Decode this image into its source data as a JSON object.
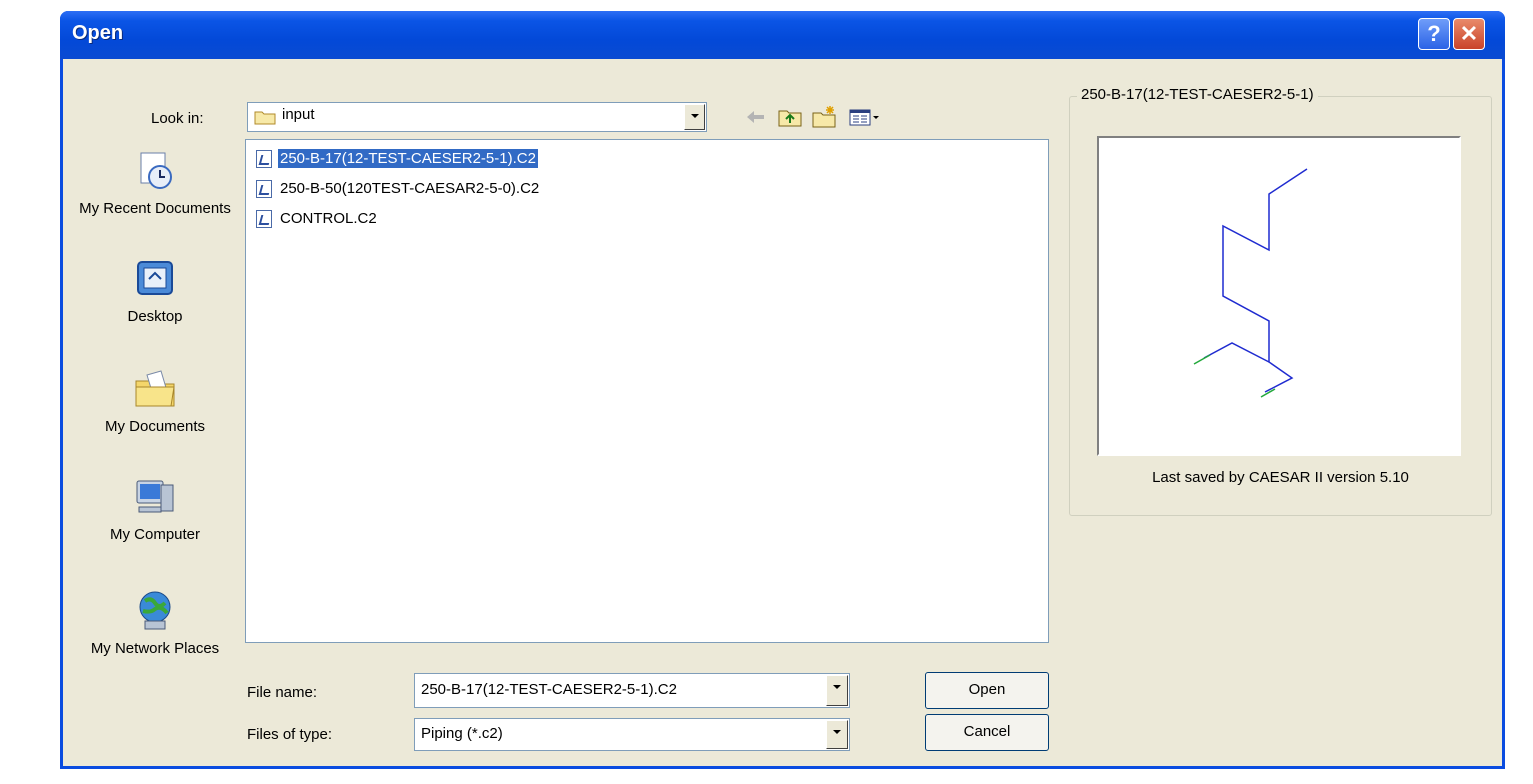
{
  "window": {
    "title": "Open",
    "help_glyph": "?",
    "close_glyph": "✕"
  },
  "look_in": {
    "label": "Look in:",
    "value": "input"
  },
  "places": [
    {
      "label": "My Recent Documents"
    },
    {
      "label": "Desktop"
    },
    {
      "label": "My Documents"
    },
    {
      "label": "My Computer"
    },
    {
      "label": "My Network Places"
    }
  ],
  "files": [
    {
      "name": "250-B-17(12-TEST-CAESER2-5-1).C2",
      "selected": true
    },
    {
      "name": "250-B-50(120TEST-CAESAR2-5-0).C2",
      "selected": false
    },
    {
      "name": "CONTROL.C2",
      "selected": false
    }
  ],
  "file_name": {
    "label": "File name:",
    "value": "250-B-17(12-TEST-CAESER2-5-1).C2"
  },
  "file_type": {
    "label": "Files of type:",
    "value": "Piping (*.c2)"
  },
  "buttons": {
    "open": "Open",
    "cancel": "Cancel"
  },
  "preview": {
    "caption": "250-B-17(12-TEST-CAESER2-5-1)",
    "status": "Last saved by CAESAR II version 5.10"
  },
  "colors": {
    "titlebar": "#0a4ce0",
    "selection": "#316ac5",
    "pipe": "#1f2bd0",
    "restraint": "#22a83a"
  },
  "icons": {
    "back": "back-arrow-icon",
    "up": "up-folder-icon",
    "new_folder": "new-folder-icon",
    "views": "views-menu-icon"
  }
}
